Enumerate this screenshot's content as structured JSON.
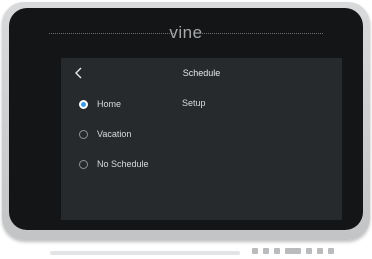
{
  "device": {
    "brand": "vine"
  },
  "screen": {
    "title": "Schedule",
    "back_icon": "chevron-left-icon",
    "setup_label": "Setup",
    "options": [
      {
        "label": "Home",
        "selected": true
      },
      {
        "label": "Vacation",
        "selected": false
      },
      {
        "label": "No Schedule",
        "selected": false
      }
    ]
  },
  "colors": {
    "accent": "#3f9be6",
    "screen_bg": "#262a2d",
    "bezel": "#131516"
  }
}
